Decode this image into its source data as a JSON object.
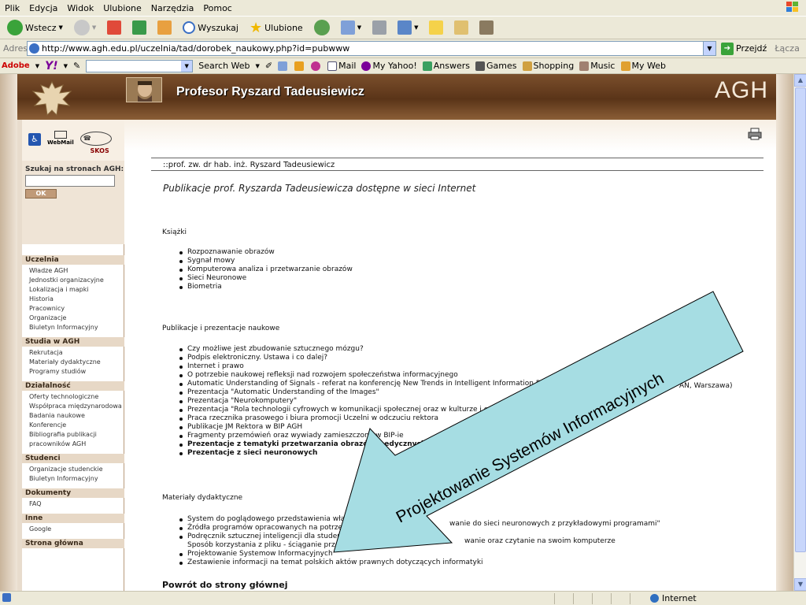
{
  "menu": [
    "Plik",
    "Edycja",
    "Widok",
    "Ulubione",
    "Narzędzia",
    "Pomoc"
  ],
  "toolbar": {
    "back": "Wstecz",
    "search": "Wyszukaj",
    "favorites": "Ulubione"
  },
  "address": {
    "label": "Adres",
    "url": "http://www.agh.edu.pl/uczelnia/tad/dorobek_naukowy.php?id=pubwww",
    "go": "Przejdź",
    "links": "Łącza"
  },
  "yahoo": {
    "adobe": "Adobe",
    "logo": "Y!",
    "search_web": "Search Web",
    "mail": "Mail",
    "my_yahoo": "My Yahoo!",
    "answers": "Answers",
    "games": "Games",
    "shopping": "Shopping",
    "music": "Music",
    "my_web": "My Web"
  },
  "banner": {
    "name": "Profesor  Ryszard Tadeusiewicz",
    "agh": "AGH"
  },
  "left": {
    "webmail": "WebMail",
    "skos": "SKOS",
    "search_title": "Szukaj na stronach AGH:",
    "ok": "OK",
    "sections": [
      {
        "head": "Uczelnia",
        "items": [
          "Władze AGH",
          "Jednostki organizacyjne",
          "Lokalizacja i mapki",
          "Historia",
          "Pracownicy",
          "Organizacje",
          "Biuletyn Informacyjny"
        ]
      },
      {
        "head": "Studia w AGH",
        "items": [
          "Rekrutacja",
          "Materiały dydaktyczne",
          "Programy studiów"
        ]
      },
      {
        "head": "Działalność",
        "items": [
          "Oferty technologiczne",
          "Współpraca międzynarodowa",
          "Badania naukowe",
          "Konferencje",
          "Bibliografia publikacji",
          "pracowników AGH"
        ]
      },
      {
        "head": "Studenci",
        "items": [
          "Organizacje studenckie",
          "Biuletyn Informacyjny"
        ]
      },
      {
        "head": "Dokumenty",
        "items": [
          "FAQ"
        ]
      },
      {
        "head": "Inne",
        "items": [
          "Google"
        ]
      },
      {
        "head": "Strona główna",
        "items": []
      }
    ]
  },
  "content": {
    "crumb": "::prof. zw. dr hab. inż. Ryszard Tadeusiewicz",
    "title": "Publikacje prof. Ryszarda Tadeusiewicza dostępne w sieci Internet",
    "books_head": "Książki",
    "books": [
      "Rozpoznawanie obrazów",
      "Sygnał mowy",
      "Komputerowa analiza i przetwarzanie obrazów",
      "Sieci Neuronowe",
      "Biometria"
    ],
    "pubs_head": "Publikacje i prezentacje naukowe",
    "pubs": [
      "Czy możliwe jest zbudowanie sztucznego mózgu?",
      "Podpis elektroniczny. Ustawa i co dalej?",
      "Internet i prawo",
      "O potrzebie naukowej refleksji nad rozwojem społeczeństwa informacyjnego",
      "Automatic Understanding of Signals - referat na konferencję New Trends in Intelligent Information Proce",
      "Prezentacja \"Automatic Understanding of the Images\"",
      "Prezentacja \"Neurokomputery\"",
      "Prezentacja \"Rola technologii cyfrowych w komunikacji społecznej oraz w kulturze i edukacji\"",
      "Praca rzecznika prasowego i biura promocji Uczelni w odczuciu rektora",
      "Publikacje JM Rektora w BIP AGH",
      "Fragmenty przemówień oraz wywiady zamieszczone w BIP-ie",
      "Prezentacje z tematyki przetwarzania obrazów medycznych",
      "Prezentacje z sieci neuronowych"
    ],
    "pubs_tail": "AN, Warszawa)",
    "didactic_head": "Materiały dydaktyczne",
    "didactic": [
      "System do poglądowego przedstawienia właściw",
      "Źródła programów opracowanych na potrzeby k",
      "Podręcznik sztucznej inteligencji dla studentó",
      "Sposób korzystania z pliku - ściąganie przez",
      "Projektowanie Systemow Informacyjnych",
      "Zestawienie informacji na temat polskich aktów prawnych dotyczących informatyki"
    ],
    "didactic_tail1": "wanie do sieci neuronowych z przykładowymi programami\"",
    "didactic_tail2": "wanie oraz czytanie na swoim komputerze",
    "back": "Powrót do strony głównej"
  },
  "annotation": {
    "arrow_text": "Projektowanie Systemów Informacyjnych",
    "fill": "#a6dde3"
  },
  "status": {
    "zone": "Internet"
  }
}
